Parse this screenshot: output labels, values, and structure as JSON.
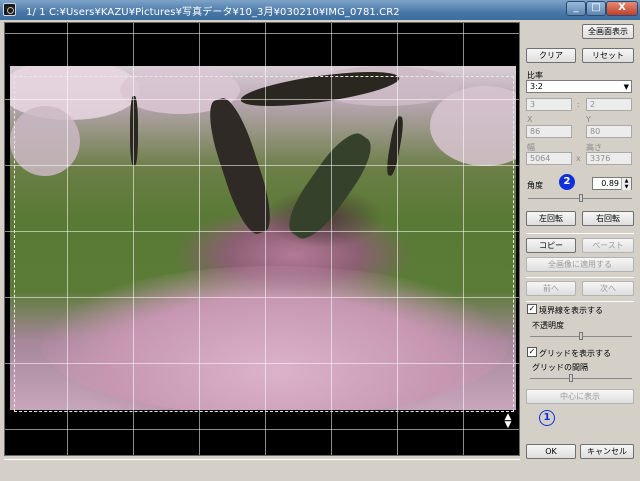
{
  "window": {
    "title": "1/  1  C:¥Users¥KAZU¥Pictures¥写真データ¥10_3月¥030210¥IMG_0781.CR2",
    "minimize": "_",
    "maximize": "□",
    "close": "X"
  },
  "panel": {
    "fullscreen_button": "全画面表示",
    "clear_button": "クリア",
    "reset_button": "リセット",
    "ratio_label": "比率",
    "ratio_value": "3:2",
    "ratio_w": "3",
    "ratio_sep": ":",
    "ratio_h": "2",
    "x_label": "X",
    "x_value": "86",
    "y_label": "Y",
    "y_value": "80",
    "width_label": "幅",
    "width_value": "5064",
    "height_label": "高さ",
    "height_value": "3376",
    "size_sep": "x",
    "angle_label": "角度",
    "angle_value": "0.89",
    "angle_slider_fraction": 0.51,
    "rotate_left_button": "左回転",
    "rotate_right_button": "右回転",
    "copy_button": "コピー",
    "paste_button": "ペースト",
    "apply_all_button": "全画像に適用する",
    "prev_button": "前へ",
    "next_button": "次へ",
    "show_border_label": "境界線を表示する",
    "show_border_checked": true,
    "opacity_label": "不透明度",
    "opacity_slider_fraction": 0.5,
    "show_grid_label": "グリッドを表示する",
    "show_grid_checked": true,
    "grid_spacing_label": "グリッドの間隔",
    "grid_slider_fraction": 0.4,
    "center_button": "中心に表示",
    "ok_button": "OK",
    "cancel_button": "キャンセル"
  },
  "annotations": {
    "marker_1": "1",
    "marker_2": "2",
    "color": "#1030d8"
  }
}
